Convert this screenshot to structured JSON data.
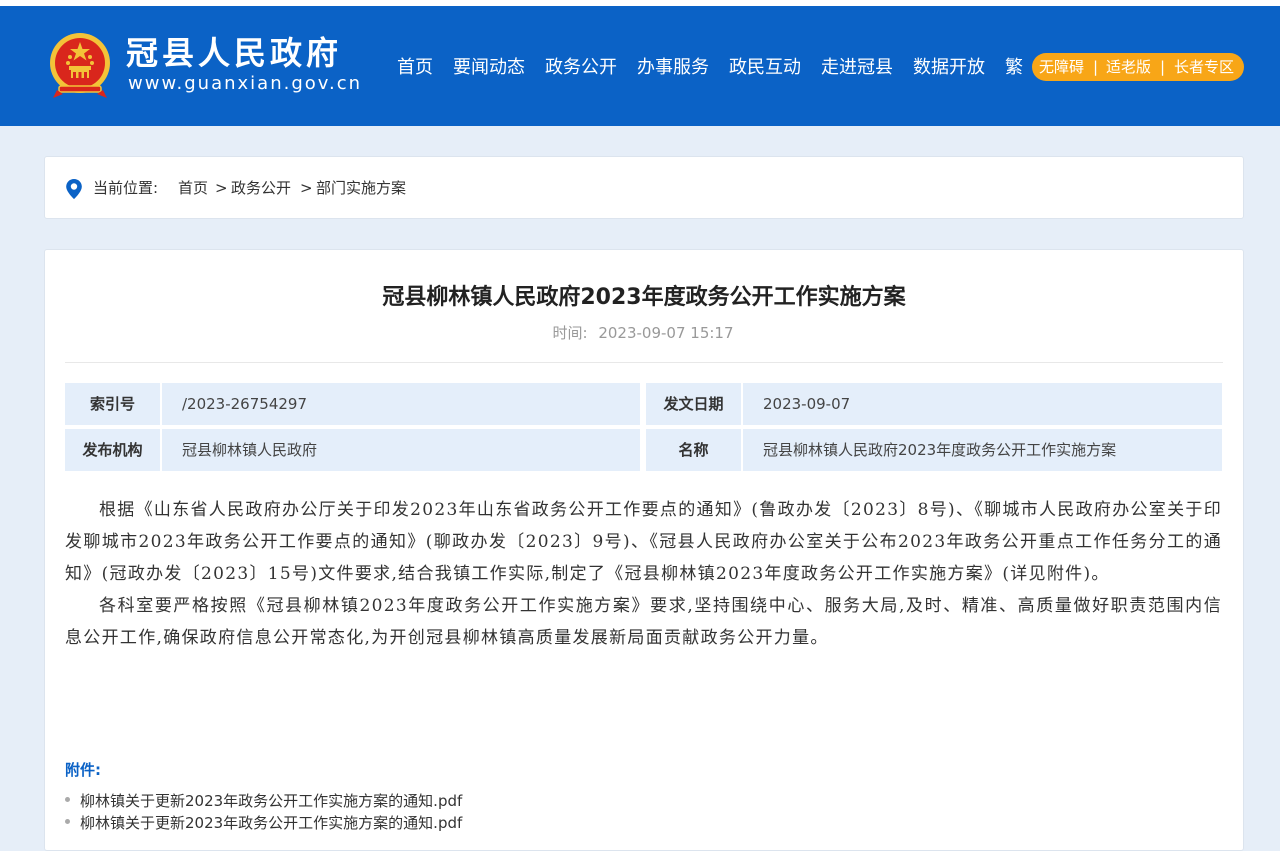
{
  "header": {
    "site_name": "冠县人民政府",
    "site_domain": "www.guanxian.gov.cn",
    "nav": [
      "首页",
      "要闻动态",
      "政务公开",
      "办事服务",
      "政民互动",
      "走进冠县",
      "数据开放",
      "繁"
    ],
    "accessibility": {
      "barrier_free": "无障碍",
      "elderly_version": "适老版",
      "senior_zone": "长者专区",
      "separator": "|"
    },
    "colors": {
      "header_bg": "#0b62c6",
      "accent": "#f8a617",
      "emblem_red": "#d9261c",
      "emblem_gold": "#f3c338"
    }
  },
  "breadcrumb": {
    "prefix": "当前位置:",
    "items": [
      "首页",
      "政务公开",
      "部门实施方案"
    ],
    "separator": ">"
  },
  "article": {
    "title": "冠县柳林镇人民政府2023年度政务公开工作实施方案",
    "time_label": "时间:",
    "time_value": "2023-09-07 15:17",
    "meta": {
      "index_label": "索引号",
      "index_value": "/2023-26754297",
      "date_label": "发文日期",
      "date_value": "2023-09-07",
      "org_label": "发布机构",
      "org_value": "冠县柳林镇人民政府",
      "name_label": "名称",
      "name_value": "冠县柳林镇人民政府2023年度政务公开工作实施方案"
    },
    "paragraphs": [
      "根据《山东省人民政府办公厅关于印发2023年山东省政务公开工作要点的通知》(鲁政办发〔2023〕8号)、《聊城市人民政府办公室关于印发聊城市2023年政务公开工作要点的通知》(聊政办发〔2023〕9号)、《冠县人民政府办公室关于公布2023年政务公开重点工作任务分工的通知》(冠政办发〔2023〕15号)文件要求,结合我镇工作实际,制定了《冠县柳林镇2023年度政务公开工作实施方案》(详见附件)。",
      "各科室要严格按照《冠县柳林镇2023年度政务公开工作实施方案》要求,坚持围绕中心、服务大局,及时、精准、高质量做好职责范围内信息公开工作,确保政府信息公开常态化,为开创冠县柳林镇高质量发展新局面贡献政务公开力量。"
    ],
    "attachments_label": "附件:",
    "attachments": [
      "柳林镇关于更新2023年政务公开工作实施方案的通知.pdf",
      "柳林镇关于更新2023年政务公开工作实施方案的通知.pdf"
    ]
  }
}
